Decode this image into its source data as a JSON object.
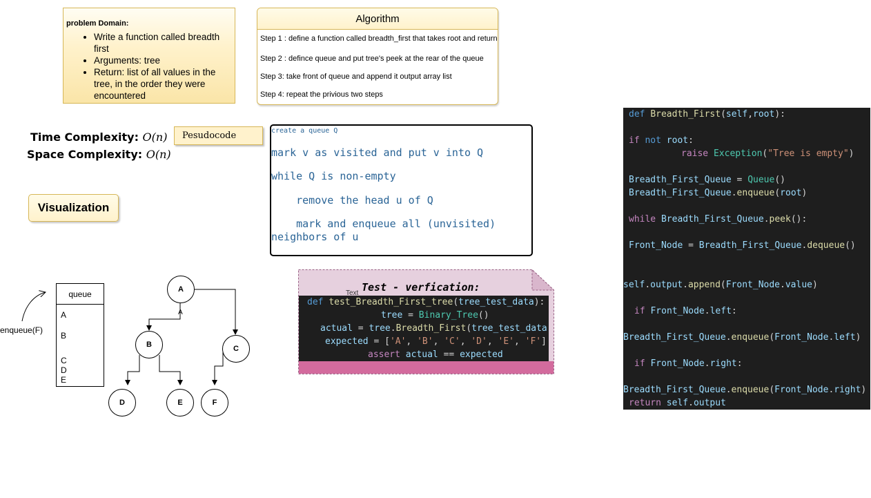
{
  "problem": {
    "title": "problem Domain:",
    "items": [
      "Write a function called breadth first",
      "Arguments: tree",
      "Return: list of all values in the tree, in the order they were encountered"
    ]
  },
  "algorithm": {
    "title": "Algorithm",
    "steps": [
      "Step 1 : define a function called breadth_first that takes root and return",
      "Step 2 : defince queue and put tree's peek at the rear of the queue",
      "Step 3: take front of queue and append it output array list",
      "Step 4: repeat the privious two steps"
    ]
  },
  "complexity": {
    "time_label": "Time Complexity:",
    "time_value": "O(n)",
    "space_label": "Space Complexity:",
    "space_value": "O(n)"
  },
  "pseudocode": {
    "label": "Pesudocode",
    "line1": "create a queue Q",
    "line2": "mark v as visited and put v into Q",
    "line3": "while Q is non-empty",
    "line4": "    remove the head u of Q",
    "line5a": "    mark and enqueue all (unvisited)",
    "line5b": "neighbors of u"
  },
  "visualization": {
    "label": "Visualization"
  },
  "test": {
    "title": "Test - verfication:",
    "text_tag": "Text",
    "code": {
      "l1_kw": "def",
      "l1_fn": "test_Breadth_First_tree",
      "l1_p1": "(",
      "l1_arg": "tree_test_data",
      "l1_p2": "):",
      "l2_var": "tree",
      "l2_eq": " = ",
      "l2_cls": "Binary_Tree",
      "l2_p": "()",
      "l3_var": "actual",
      "l3_eq": " = ",
      "l3_obj": "tree",
      "l3_dot": ".",
      "l3_fn": "Breadth_First",
      "l3_p1": "(",
      "l3_arg": "tree_test_data",
      "l3_p2": ")",
      "l4_var": "expected",
      "l4_eq": " = [",
      "l4_s1": "'A'",
      "l4_s2": "'B'",
      "l4_s3": "'C'",
      "l4_s4": "'D'",
      "l4_s5": "'E'",
      "l4_s6": "'F'",
      "l4_sep": ", ",
      "l4_end": "]",
      "l5_kw": "assert",
      "l5_a": "actual",
      "l5_op": " == ",
      "l5_b": "expected"
    }
  },
  "code": {
    "def": "def",
    "fname": "Breadth_First",
    "p_open": "(",
    "self": "self",
    "comma": ",",
    "root": "root",
    "p_close": "):",
    "if": "if",
    "not": "not",
    "colon": ":",
    "raise": "raise",
    "exc": "Exception",
    "paren_o": "(",
    "msg": "\"Tree is empty\"",
    "paren_c": ")",
    "queue_var": "Breadth_First_Queue",
    "eq": " = ",
    "queue_cls": "Queue",
    "empty_call": "()",
    "dot": ".",
    "enqueue": "enqueue",
    "while": "while",
    "peek": "peek",
    "peek_end": "():",
    "front": "Front_Node",
    "dequeue": "dequeue",
    "output": "output",
    "append": "append",
    "value": "value",
    "left": "left",
    "right": "right",
    "return": "return"
  },
  "queue": {
    "header": "queue",
    "items": [
      "A",
      "B",
      "C",
      "D",
      "E"
    ],
    "enqueue_label": "enqueue(F)"
  },
  "tree": {
    "nodes": [
      "A",
      "B",
      "C",
      "D",
      "E",
      "F"
    ],
    "edge_label": "A"
  }
}
